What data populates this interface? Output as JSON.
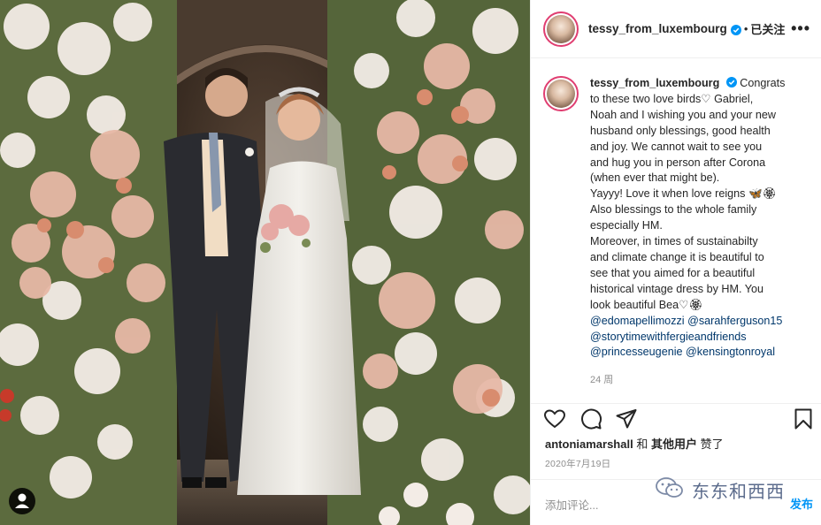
{
  "header": {
    "username": "tessy_from_luxembourg",
    "separator": "•",
    "follow_label": "已关注",
    "more_label": "•••"
  },
  "caption": {
    "username": "tessy_from_luxembourg",
    "lines": [
      "Congrats",
      "to these two love birds♡ Gabriel,",
      "Noah and I wishing you and your new",
      "husband only blessings, good health",
      "and joy. We cannot wait to see you",
      "and hug you in person after Corona",
      "(when ever that might be).",
      "Yayyy! Love it when love reigns 🦋🏵",
      "Also blessings to the whole family",
      "especially HM.",
      "Moreover, in times of sustainabilty",
      "and climate change it is beautiful to",
      "see that you aimed for a beautiful",
      "historical vintage dress by HM. You",
      "look beautiful Bea♡🏵"
    ],
    "mentions": [
      "@edomapellimozzi",
      "@sarahferguson15",
      "@storytimewithfergieandfriends",
      "@princesseugenie",
      "@kensingtonroyal"
    ],
    "time_ago": "24 周"
  },
  "actions": {
    "like_icon": "heart-icon",
    "comment_icon": "comment-icon",
    "share_icon": "paper-plane-icon",
    "save_icon": "bookmark-icon"
  },
  "likes": {
    "user": "antoniamarshall",
    "and": "和",
    "others": "其他用户",
    "liked": "赞了"
  },
  "post_date": "2020年7月19日",
  "comment": {
    "placeholder": "添加评论...",
    "publish_label": "发布"
  },
  "watermark": {
    "text": "东东和西西"
  },
  "colors": {
    "verified": "#0095f6",
    "mention": "#00376b",
    "story_ring": "#e03e71",
    "publish": "#0095f6"
  }
}
